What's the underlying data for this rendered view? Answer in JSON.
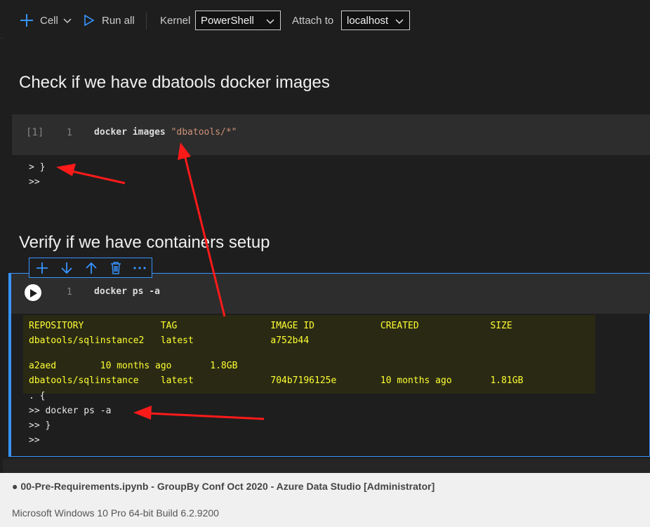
{
  "toolbar": {
    "cell_label": "Cell",
    "run_all_label": "Run all",
    "kernel_label": "Kernel",
    "kernel_value": "PowerShell",
    "attach_label": "Attach to",
    "attach_value": "localhost"
  },
  "cells": {
    "heading1": "Check if we have dbatools docker images",
    "cell1": {
      "exec_count": "[1]",
      "line_no": "1",
      "code_cmd": "docker images ",
      "code_str": "\"dbatools/*\"",
      "output": [
        "> }",
        ">>"
      ]
    },
    "heading2": "Verify if we have containers setup",
    "cell2": {
      "line_no": "1",
      "code": "docker ps -a",
      "table_lines": [
        "REPOSITORY              TAG                 IMAGE ID            CREATED             SIZE",
        "dbatools/sqlinstance2   latest              a752b44",
        "",
        "a2aed        10 months ago       1.8GB",
        "dbatools/sqlinstance    latest              704b7196125e        10 months ago       1.81GB"
      ],
      "output": [
        ". {",
        ">> docker ps -a",
        ">> }",
        ">>"
      ]
    }
  },
  "status": {
    "window_title": "● 00-Pre-Requirements.ipynb - GroupBy Conf Oct 2020 - Azure Data Studio [Administrator]",
    "os_info": "Microsoft Windows 10 Pro 64-bit Build 6.2.9200"
  },
  "colors": {
    "accent": "#3794ff",
    "annotation_arrow": "#ff1a1a",
    "table_text": "#ffff33",
    "string": "#ce9178"
  }
}
